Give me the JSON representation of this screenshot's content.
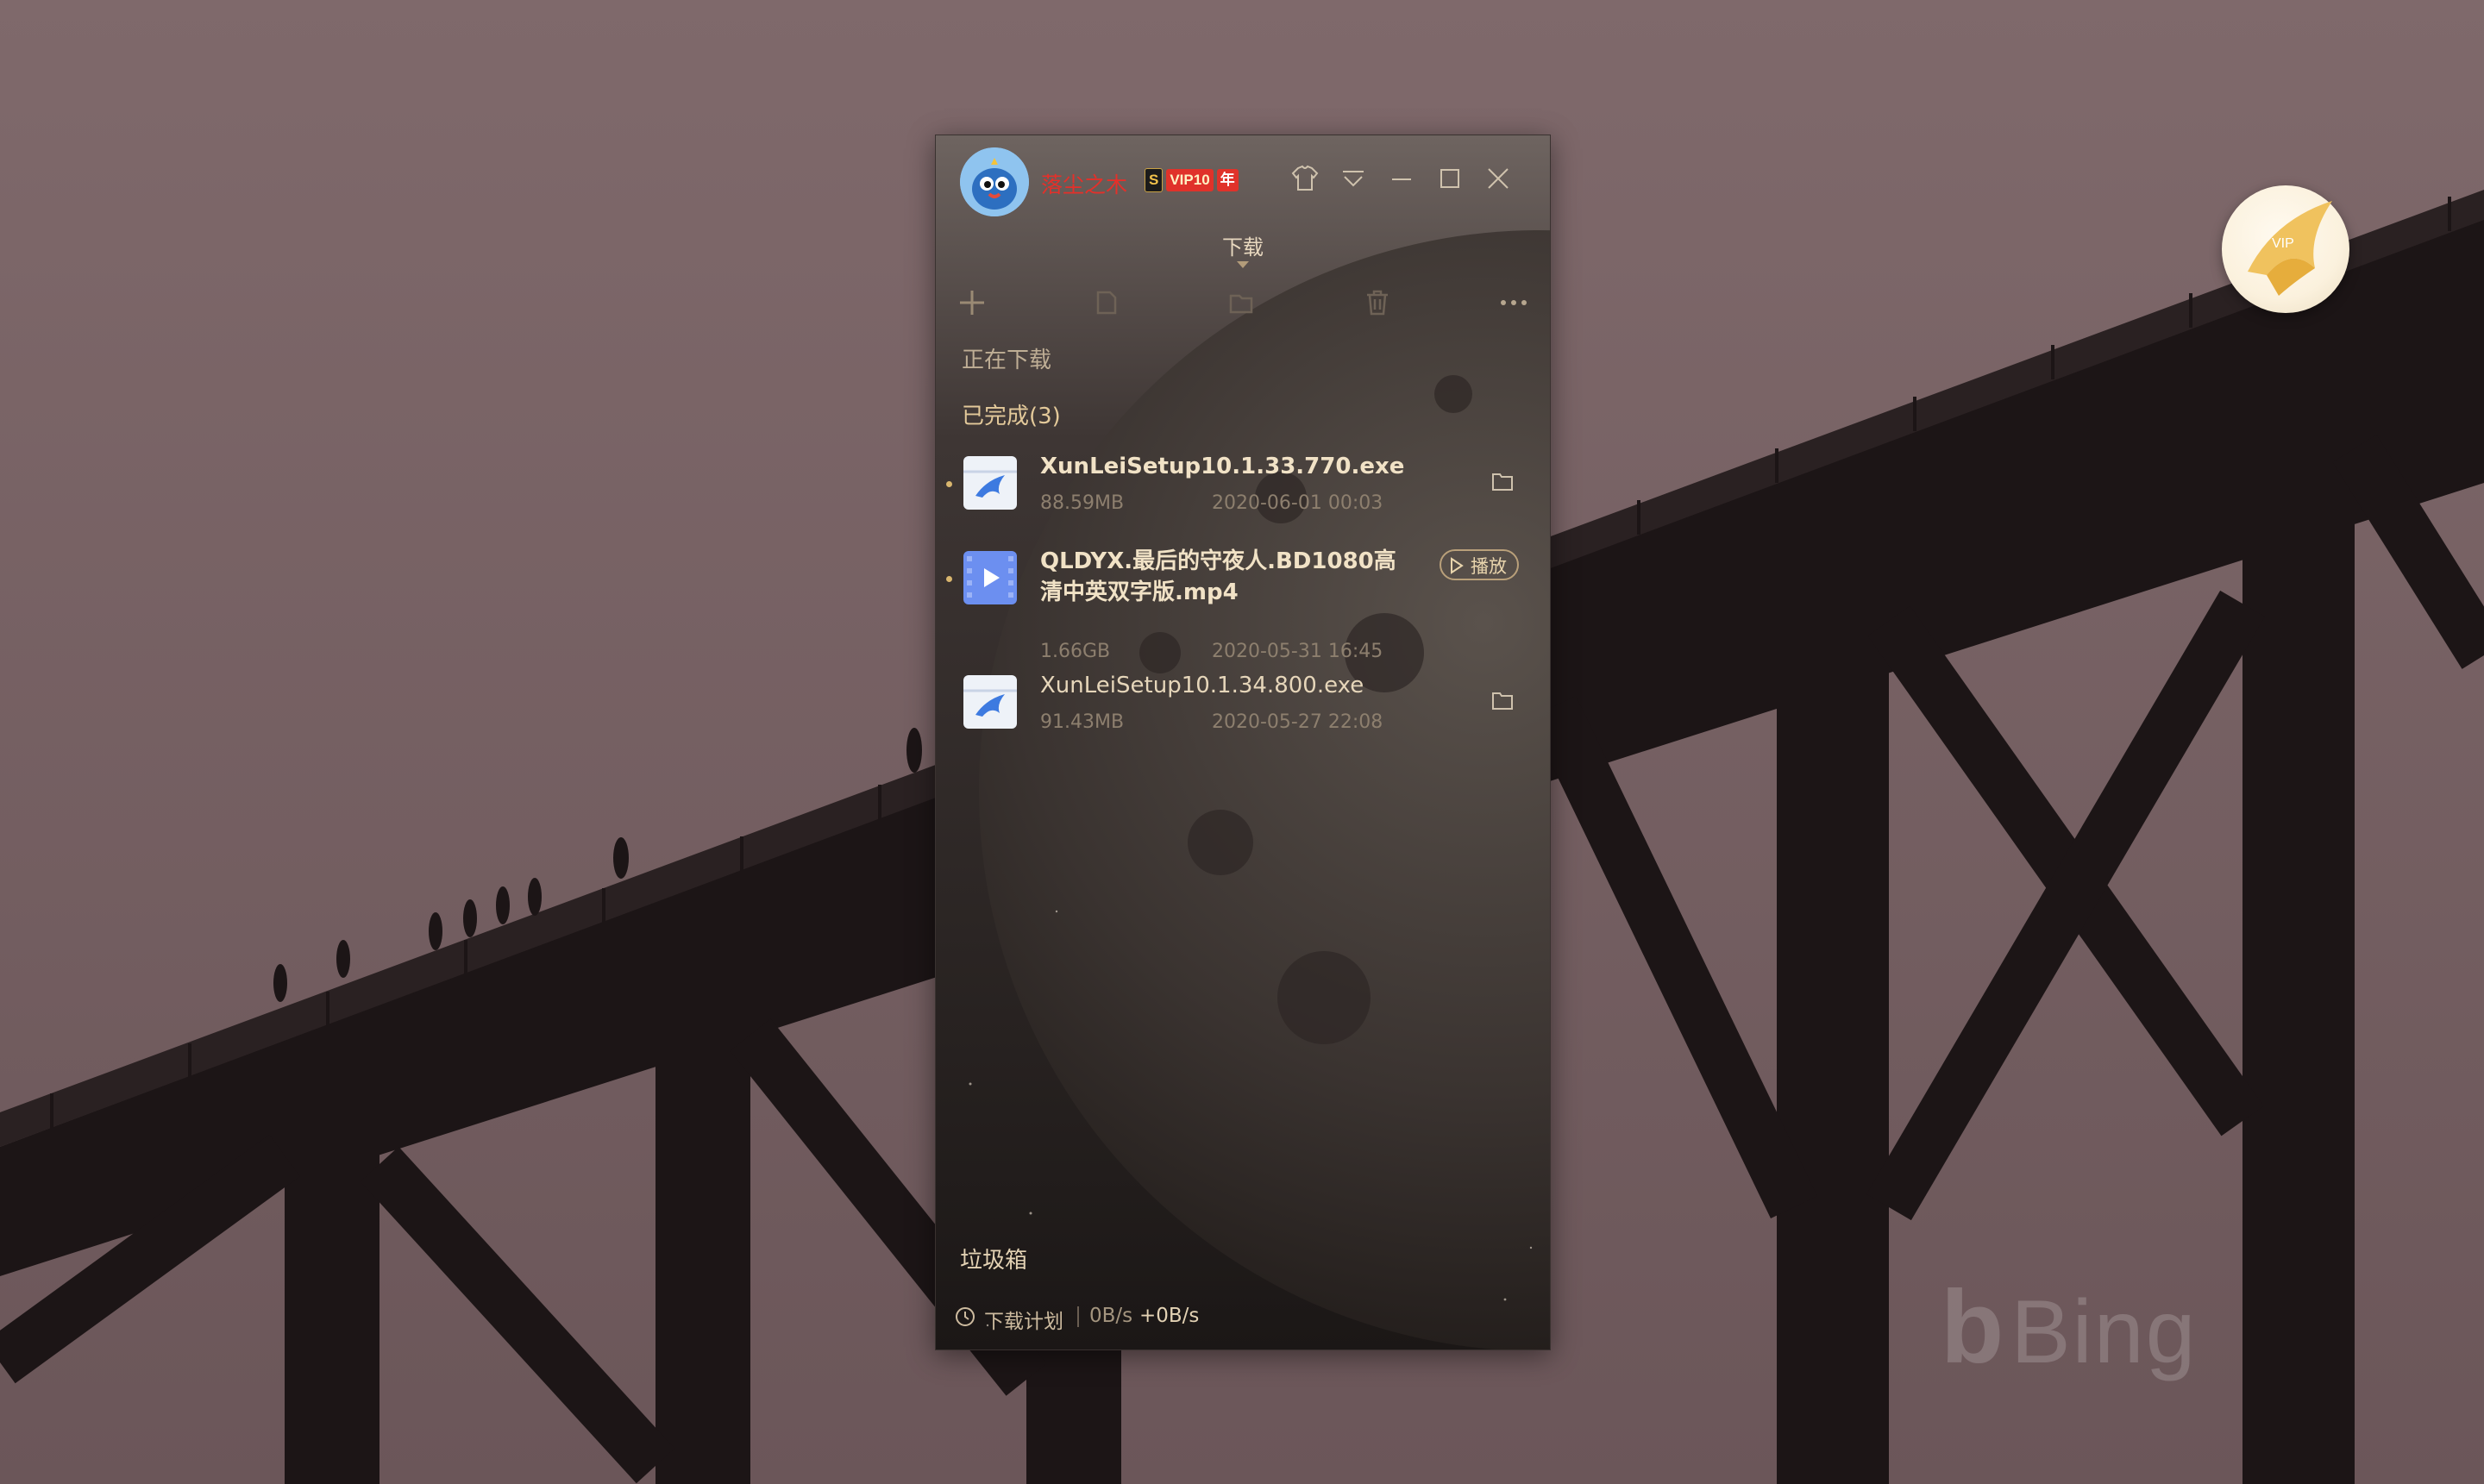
{
  "user": {
    "name": "落尘之木",
    "badge_s": "S",
    "badge_vip": "VIP10",
    "badge_year": "年"
  },
  "window_tab": "下载",
  "titlebar_icons": [
    "skin-icon",
    "menu-icon",
    "minimize-icon",
    "maximize-icon",
    "close-icon"
  ],
  "toolbar_icons": [
    "add-icon",
    "start-icon",
    "folder-icon",
    "delete-icon",
    "more-icon"
  ],
  "sections": {
    "downloading": "正在下载",
    "completed": "已完成(3)",
    "trash": "垃圾箱"
  },
  "downloads": [
    {
      "name": "XunLeiSetup10.1.33.770.exe",
      "size": "88.59MB",
      "date": "2020-06-01 00:03",
      "type": "exe",
      "action": "open-folder"
    },
    {
      "name_line1": "QLDYX.最后的守夜人.BD1080高",
      "name_line2": "清中英双字版.mp4",
      "size": "1.66GB",
      "date": "2020-05-31 16:45",
      "type": "video",
      "action": "play",
      "action_label": "播放"
    },
    {
      "name": "XunLeiSetup10.1.34.800.exe",
      "size": "91.43MB",
      "date": "2020-05-27 22:08",
      "type": "exe",
      "action": "open-folder"
    }
  ],
  "status": {
    "plan_label": "下载计划",
    "speed_down": "0B/s",
    "speed_up": "+0B/s"
  },
  "desktop": {
    "watermark": "Bing",
    "floating_badge": "VIP"
  },
  "colors": {
    "accent_gold": "#e3c99a",
    "username_red": "#e4302a",
    "window_bg": "#1e1a19"
  }
}
